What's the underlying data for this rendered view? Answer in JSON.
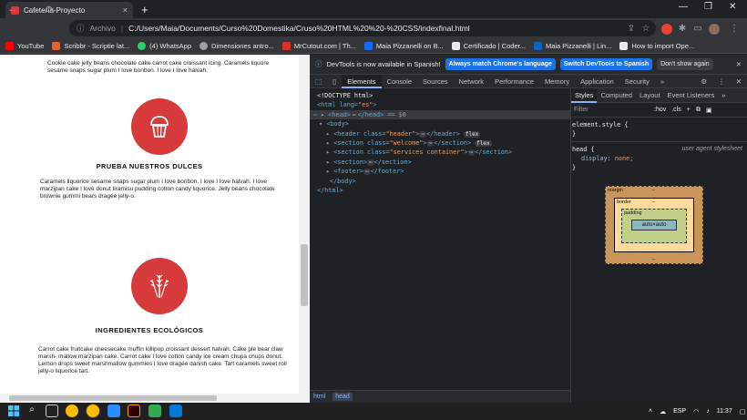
{
  "browser": {
    "tab_title": "Cafetería-Proyecto",
    "tab_close": "×",
    "new_tab": "+",
    "window_controls": [
      "—",
      "❐",
      "✕"
    ],
    "nav": [
      "←",
      "→",
      "⟳"
    ],
    "address_label": "Archivo",
    "address_url": "C:/Users/Maia/Documents/Curso%20Domestika/Cruso%20HTML%20%20-%20CSS/indexfinal.html",
    "bookmarks": [
      {
        "label": "YouTube",
        "color": "#ff0000"
      },
      {
        "label": "Scribbr - Scriptie lat...",
        "color": "#e95f2f"
      },
      {
        "label": "(4) WhatsApp",
        "color": "#25d366"
      },
      {
        "label": "Dimensiones antro...",
        "color": "#9aa0a6"
      },
      {
        "label": "MrCutout.com | Th...",
        "color": "#9aa0a6"
      },
      {
        "label": "Maia Pizzanelli on B...",
        "color": "#1769ff"
      },
      {
        "label": "Certificado | Coder...",
        "color": "#9aa0a6"
      },
      {
        "label": "Maia Pizzanelli | Lin...",
        "color": "#0a66c2"
      },
      {
        "label": "How to import Ope...",
        "color": "#9aa0a6"
      }
    ]
  },
  "page": {
    "top_text": "Cookie cake jelly beans chocolate cake carrot cake croissant icing. Caramels liquore sesame snaps sugar plum I love bonbon. I love I love halvah.",
    "section1": {
      "title": "PRUEBA NUESTROS DULCES",
      "text": "Caramels liquorice sesame snaps sugar plum I love bonbon. I love I love halvah. I love marzipan cake I love donut tiramisu pudding cotton candy liquorice. Jelly beans chocolate brownie gummi bears dragée jelly-o."
    },
    "section2": {
      "title": "INGREDIENTES ECOLÓGICOS",
      "text": "Carrot cake fruitcake cheesecake muffin lollipop croissant dessert halvah. Cake pie bear claw marsh- mallow marzipan cake. Carrot cake I love cotton candy ice cream chupa chups donut. Lemon drops sweet marshmallow gummies I love dragée danish cake. Tart caramels sweet roll jelly-o liquorice tart."
    }
  },
  "devtools": {
    "info_text": "DevTools is now available in Spanish!",
    "btn_match": "Always match Chrome's language",
    "btn_switch": "Switch DevTools to Spanish",
    "btn_dont": "Don't show again",
    "tabs": [
      "Elements",
      "Console",
      "Sources",
      "Network",
      "Performance",
      "Memory",
      "Application",
      "Security",
      "»"
    ],
    "dom": {
      "doctype": "<!DOCTYPE html>",
      "html_open": "<html lang=",
      "html_lang": "\"es\"",
      "head": "<head>",
      "head_dots": "⋯",
      "head_close": "</head>",
      "head_eq": "== $0",
      "body": "<body>",
      "header_tag": "<header class=",
      "header_class": "\"header\"",
      "header_close": "</header>",
      "section1_tag": "<section class=",
      "section1_class": "\"welcome\"",
      "section_close": "</section>",
      "section2_tag": "<section class=",
      "section2_class": "\"services container\"",
      "section3_tag": "<section>",
      "footer_tag": "<footer>",
      "footer_close": "</footer>",
      "body_close": "</body>",
      "html_close": "</html>",
      "badge": "flex",
      "dots": "⋯"
    },
    "breadcrumbs": [
      "html",
      "head"
    ],
    "styles_tabs": [
      "Styles",
      "Computed",
      "Layout",
      "Event Listeners",
      "»"
    ],
    "filter_placeholder": "Filter",
    "filter_hov": ":hov",
    "filter_cls": ".cls",
    "element_style": "element.style {",
    "brace_close": "}",
    "rule_selector": "head {",
    "rule_source": "user agent stylesheet",
    "rule_prop": "display",
    "rule_val": "none;",
    "box": {
      "margin": "margin",
      "border": "border",
      "padding": "padding",
      "content": "auto×auto",
      "dash": "–"
    }
  },
  "taskbar": {
    "lang": "ESP",
    "time": "11:37"
  }
}
